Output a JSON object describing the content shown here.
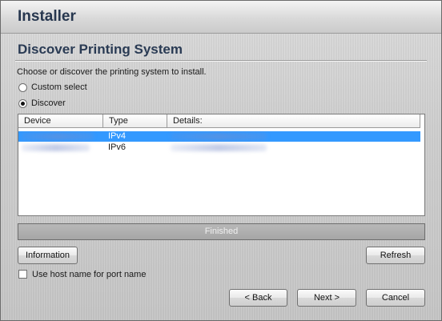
{
  "window": {
    "title": "Installer"
  },
  "page": {
    "heading": "Discover Printing System",
    "instruction": "Choose or discover the printing system to install."
  },
  "options": {
    "custom_select_label": "Custom select",
    "discover_label": "Discover",
    "selected": "discover"
  },
  "table": {
    "columns": [
      "Device",
      "Type",
      "Details:"
    ],
    "rows": [
      {
        "device": "",
        "type": "IPv4",
        "details": "",
        "selected": true
      },
      {
        "device": "",
        "type": "IPv6",
        "details": "",
        "selected": false
      }
    ]
  },
  "status": {
    "text": "Finished",
    "progress_fraction": 1.0
  },
  "buttons": {
    "information": "Information",
    "refresh": "Refresh",
    "back": "< Back",
    "next": "Next >",
    "cancel": "Cancel"
  },
  "host_name_option": {
    "label": "Use host name for port name",
    "checked": false
  }
}
